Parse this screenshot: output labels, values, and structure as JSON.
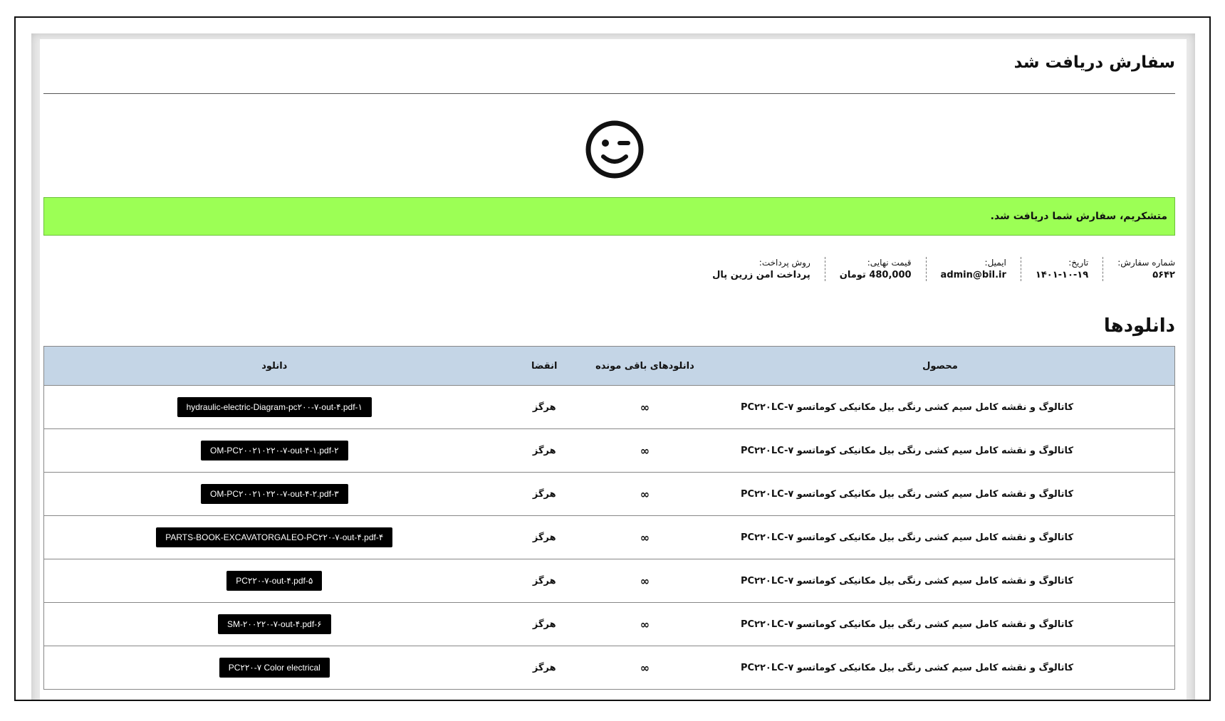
{
  "page": {
    "title": "سفارش دریافت شد",
    "notice": "متشکریم، سفارش شما دریافت شد."
  },
  "overview": [
    {
      "label": "شماره سفارش:",
      "value": "۵۶۴۲"
    },
    {
      "label": "تاریخ:",
      "value": "۱۴۰۱-۱۰-۱۹"
    },
    {
      "label": "ایمیل:",
      "value": "admin@bil.ir"
    },
    {
      "label": "قیمت نهایی:",
      "value": "480,000 تومان"
    },
    {
      "label": "روش پرداخت:",
      "value": "پرداخت امن زرین پال"
    }
  ],
  "downloads": {
    "title": "دانلودها",
    "headers": {
      "product": "محصول",
      "remaining": "دانلودهای باقی مونده",
      "expires": "انقضا",
      "file": "دانلود"
    },
    "rows": [
      {
        "product": "کاتالوگ و نقشه کامل سیم کشی رنگی بیل مکانیکی کوماتسو PC۲۲۰LC-۷",
        "remaining": "∞",
        "expires": "هرگز",
        "file": "hydraulic-electric-Diagram-pc۲۰۰-۷-out-۴.pdf-۱"
      },
      {
        "product": "کاتالوگ و نقشه کامل سیم کشی رنگی بیل مکانیکی کوماتسو PC۲۲۰LC-۷",
        "remaining": "∞",
        "expires": "هرگز",
        "file": "OM-PC۲۰۰۲۱۰۲۲۰-۷-out-۴-۱.pdf-۲"
      },
      {
        "product": "کاتالوگ و نقشه کامل سیم کشی رنگی بیل مکانیکی کوماتسو PC۲۲۰LC-۷",
        "remaining": "∞",
        "expires": "هرگز",
        "file": "OM-PC۲۰۰۲۱۰۲۲۰-۷-out-۴-۲.pdf-۳"
      },
      {
        "product": "کاتالوگ و نقشه کامل سیم کشی رنگی بیل مکانیکی کوماتسو PC۲۲۰LC-۷",
        "remaining": "∞",
        "expires": "هرگز",
        "file": "PARTS-BOOK-EXCAVATORGALEO-PC۲۲۰-۷-out-۴.pdf-۴"
      },
      {
        "product": "کاتالوگ و نقشه کامل سیم کشی رنگی بیل مکانیکی کوماتسو PC۲۲۰LC-۷",
        "remaining": "∞",
        "expires": "هرگز",
        "file": "PC۲۲۰-۷-out-۴.pdf-۵"
      },
      {
        "product": "کاتالوگ و نقشه کامل سیم کشی رنگی بیل مکانیکی کوماتسو PC۲۲۰LC-۷",
        "remaining": "∞",
        "expires": "هرگز",
        "file": "SM-۲۰۰۲۲۰-۷-out-۴.pdf-۶"
      },
      {
        "product": "کاتالوگ و نقشه کامل سیم کشی رنگی بیل مکانیکی کوماتسو PC۲۲۰LC-۷",
        "remaining": "∞",
        "expires": "هرگز",
        "file": "PC۲۲۰-۷ Color electrical"
      }
    ]
  },
  "icons": {
    "status_icon": "wink-smiley-icon"
  },
  "colors": {
    "notice_bg": "#9cff55",
    "table_header_bg": "#c4d5e6",
    "download_button_bg": "#000000"
  }
}
